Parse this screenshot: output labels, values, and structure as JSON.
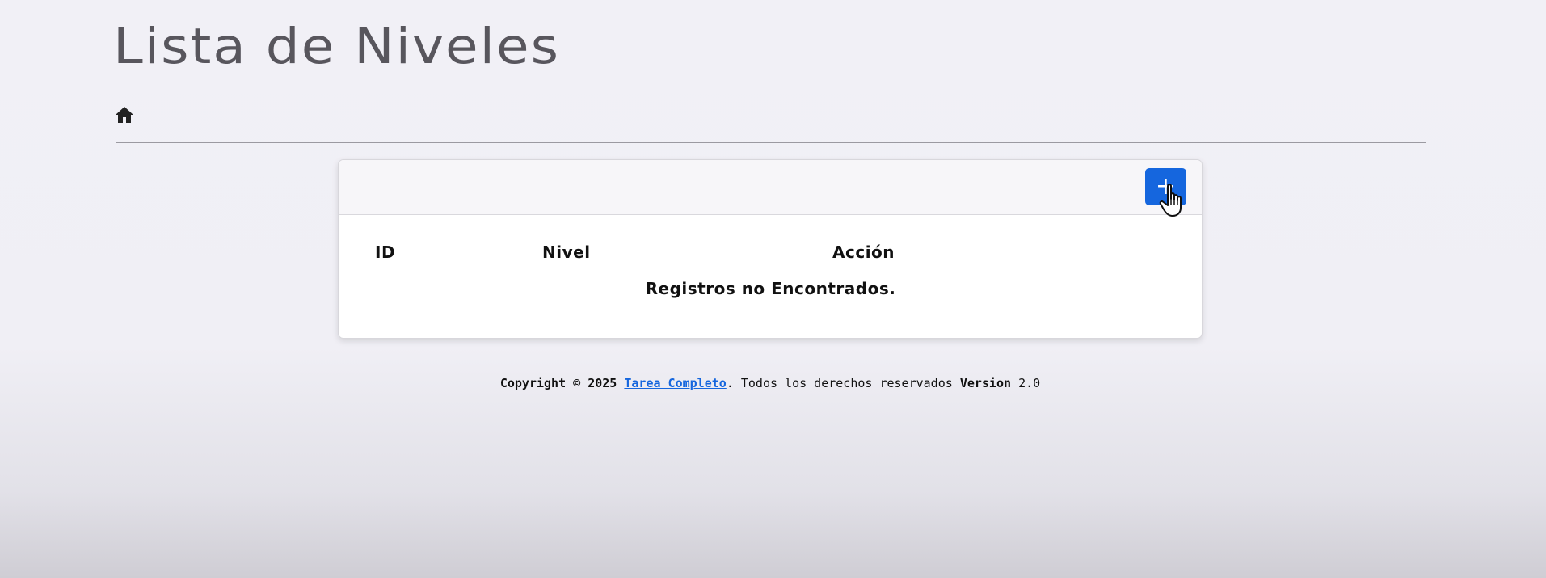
{
  "header": {
    "title": "Lista de Niveles",
    "home_icon": "home-icon"
  },
  "card": {
    "add_button_label": "+",
    "table": {
      "columns": [
        "ID",
        "Nivel",
        "Acción"
      ],
      "empty_message": "Registros no Encontrados."
    }
  },
  "footer": {
    "copyright": "Copyright © 2025",
    "link_text": "Tarea Completo",
    "rights": ". Todos los derechos reservados",
    "version_label": "Version",
    "version_value": "2.0"
  },
  "colors": {
    "accent": "#1566de",
    "title": "#58565d"
  }
}
